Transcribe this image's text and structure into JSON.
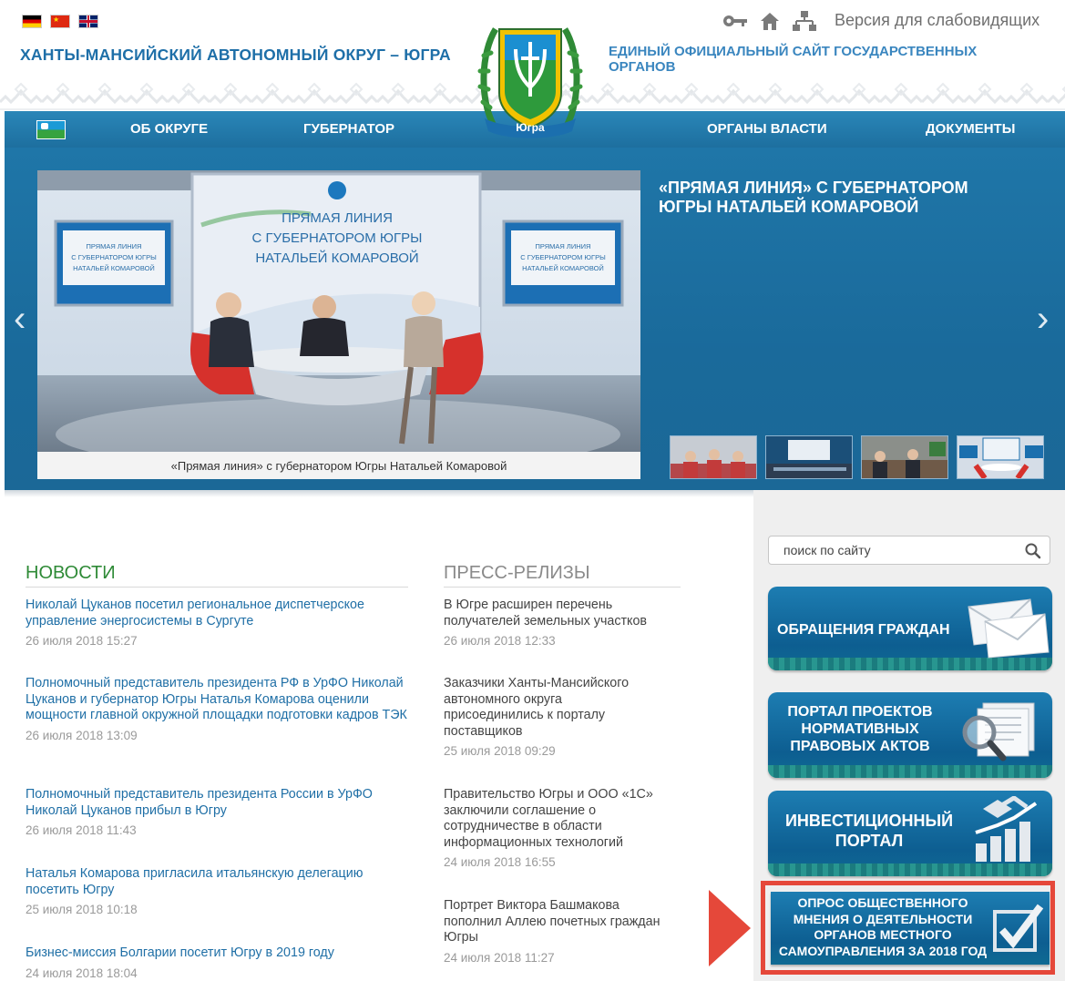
{
  "header": {
    "title": "ХАНТЫ-МАНСИЙСКИЙ АВТОНОМНЫЙ ОКРУГ – ЮГРА",
    "subtitle": "ЕДИНЫЙ ОФИЦИАЛЬНЫЙ САЙТ ГОСУДАРСТВЕННЫХ ОРГАНОВ",
    "vision_link": "Версия для слабовидящих",
    "emblem_text": "Югра",
    "flags": [
      "german-flag-icon",
      "chinese-flag-icon",
      "uk-flag-icon"
    ],
    "tool_icons": [
      "key-icon",
      "home-icon",
      "sitemap-icon"
    ]
  },
  "nav": {
    "items": [
      {
        "label": "ОБ ОКРУГЕ"
      },
      {
        "label": "ГУБЕРНАТОР"
      },
      {
        "label": "ОРГАНЫ ВЛАСТИ"
      },
      {
        "label": "ДОКУМЕНТЫ"
      }
    ]
  },
  "slider": {
    "title": "«ПРЯМАЯ ЛИНИЯ» С ГУБЕРНАТОРОМ ЮГРЫ НАТАЛЬЕЙ КОМАРОВОЙ",
    "caption": "«Прямая линия» с губернатором Югры Натальей Комаровой",
    "screen_text": [
      "ПРЯМАЯ ЛИНИЯ",
      "С ГУБЕРНАТОРОМ ЮГРЫ",
      "НАТАЛЬЕЙ КОМАРОВОЙ"
    ],
    "side_screen_text": [
      "ПРЯМАЯ ЛИНИЯ",
      "С ГУБЕРНАТОРОМ ЮГРЫ",
      "НАТАЛЬЕЙ КОМАРОВОЙ"
    ],
    "prev": "‹",
    "next": "›"
  },
  "news": {
    "title": "НОВОСТИ",
    "items": [
      {
        "text": "Николай Цуканов посетил региональное диспетчерское управление энергосистемы в Сургуте",
        "date": "26 июля 2018 15:27"
      },
      {
        "text": "Полномочный представитель президента РФ в УрФО Николай Цуканов и губернатор Югры Наталья Комарова оценили мощности главной окружной площадки подготовки кадров ТЭК",
        "date": "26 июля 2018 13:09"
      },
      {
        "text": "Полномочный представитель президента России в УрФО Николай Цуканов прибыл в Югру",
        "date": "26 июля 2018 11:43"
      },
      {
        "text": "Наталья Комарова пригласила итальянскую делегацию посетить Югру",
        "date": "25 июля 2018 10:18"
      },
      {
        "text": "Бизнес-миссия Болгарии посетит Югру в 2019 году",
        "date": "24 июля 2018 18:04"
      }
    ]
  },
  "press": {
    "title": "ПРЕСС-РЕЛИЗЫ",
    "items": [
      {
        "text": "В Югре расширен перечень получателей земельных участков",
        "date": "26 июля 2018 12:33"
      },
      {
        "text": "Заказчики Ханты-Мансийского автономного округа присоединились к порталу поставщиков",
        "date": "25 июля 2018 09:29"
      },
      {
        "text": "Правительство Югры и ООО «1С» заключили соглашение о сотрудничестве в области информационных технологий",
        "date": "24 июля 2018 16:55"
      },
      {
        "text": "Портрет Виктора Башмакова пополнил Аллею почетных граждан Югры",
        "date": "24 июля 2018 11:27"
      }
    ]
  },
  "sidebar": {
    "search_placeholder": "поиск по сайту",
    "banners": [
      {
        "label": "ОБРАЩЕНИЯ ГРАЖДАН"
      },
      {
        "label": "ПОРТАЛ ПРОЕКТОВ НОРМАТИВНЫХ ПРАВОВЫХ АКТОВ"
      },
      {
        "label": "ИНВЕСТИЦИОННЫЙ ПОРТАЛ"
      },
      {
        "label": "ОПРОС ОБЩЕСТВЕННОГО МНЕНИЯ О ДЕЯТЕЛЬНОСТИ ОРГАНОВ МЕСТНОГО САМОУПРАВЛЕНИЯ ЗА 2018 ГОД"
      }
    ]
  },
  "colors": {
    "brand_blue": "#1e6fa8",
    "nav_blue": "#2a86b8",
    "news_green": "#2e8a36",
    "highlight_red": "#e5483a"
  }
}
